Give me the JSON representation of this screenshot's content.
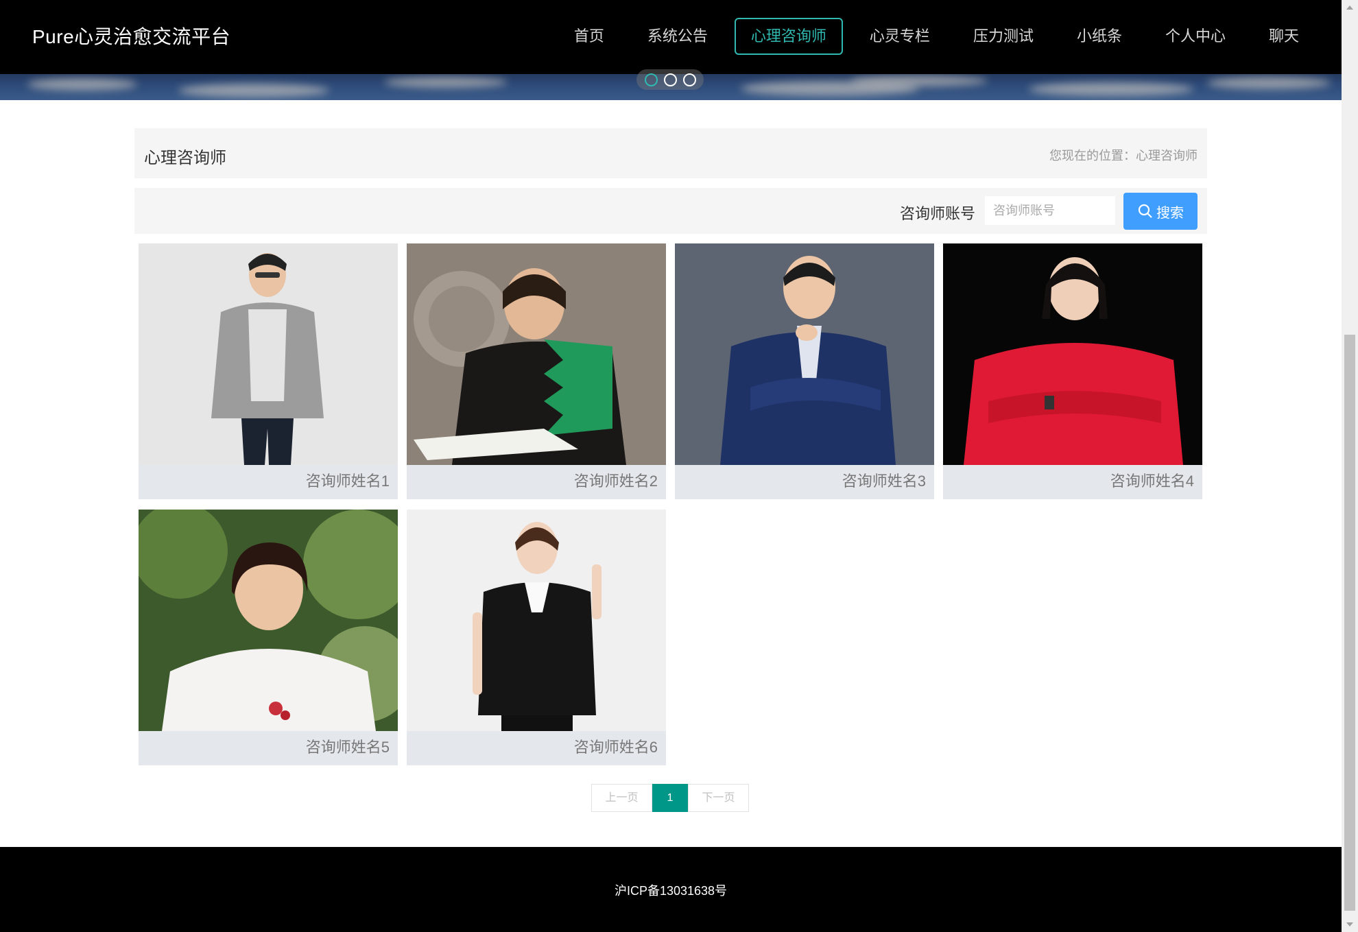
{
  "header": {
    "brand": "Pure心灵治愈交流平台",
    "nav": [
      {
        "label": "首页",
        "active": false
      },
      {
        "label": "系统公告",
        "active": false
      },
      {
        "label": "心理咨询师",
        "active": true
      },
      {
        "label": "心灵专栏",
        "active": false
      },
      {
        "label": "压力测试",
        "active": false
      },
      {
        "label": "小纸条",
        "active": false
      },
      {
        "label": "个人中心",
        "active": false
      },
      {
        "label": "聊天",
        "active": false
      }
    ]
  },
  "carousel": {
    "slide_count": 3,
    "active_index": 0
  },
  "page": {
    "title": "心理咨询师",
    "breadcrumb": "您现在的位置：心理咨询师"
  },
  "search": {
    "label": "咨询师账号",
    "placeholder": "咨询师账号",
    "value": "",
    "button_label": "搜索"
  },
  "counselors": [
    {
      "name": "咨询师姓名1"
    },
    {
      "name": "咨询师姓名2"
    },
    {
      "name": "咨询师姓名3"
    },
    {
      "name": "咨询师姓名4"
    },
    {
      "name": "咨询师姓名5"
    },
    {
      "name": "咨询师姓名6"
    }
  ],
  "pagination": {
    "prev_label": "上一页",
    "current": "1",
    "next_label": "下一页"
  },
  "footer": {
    "icp": "沪ICP备13031638号"
  },
  "colors": {
    "accent": "#2fb9b0",
    "search_button": "#409eff",
    "page_current": "#009688"
  }
}
